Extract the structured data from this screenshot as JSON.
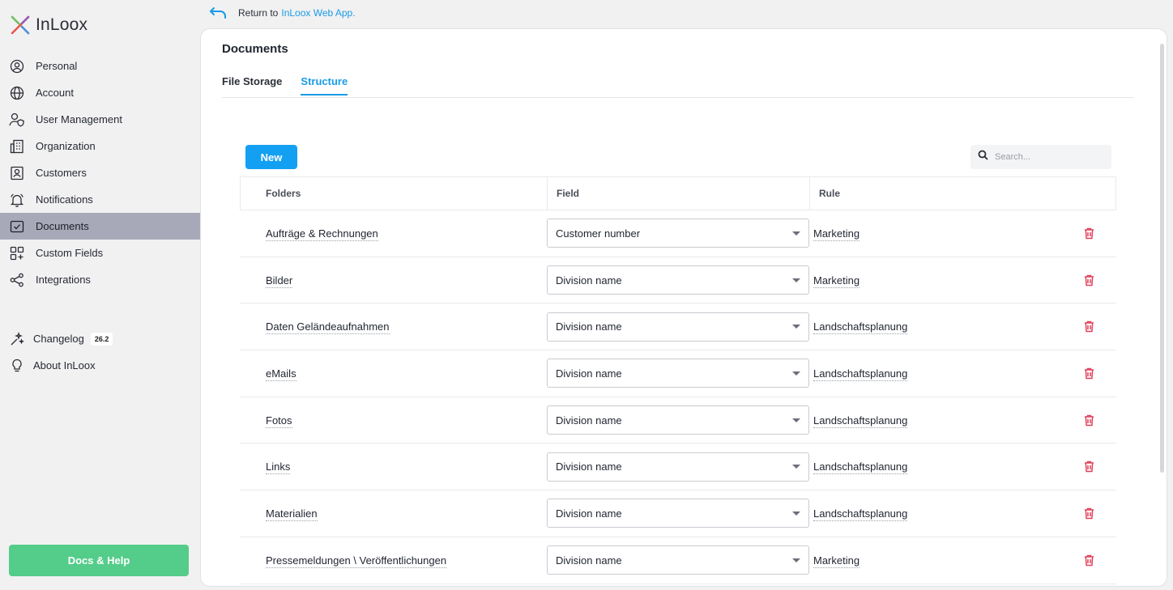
{
  "app": {
    "name": "InLoox"
  },
  "sidebar": {
    "items": [
      {
        "label": "Personal",
        "icon": "person-circle-icon"
      },
      {
        "label": "Account",
        "icon": "globe-icon"
      },
      {
        "label": "User Management",
        "icon": "user-shield-icon"
      },
      {
        "label": "Organization",
        "icon": "building-icon"
      },
      {
        "label": "Customers",
        "icon": "contact-card-icon"
      },
      {
        "label": "Notifications",
        "icon": "bell-icon"
      },
      {
        "label": "Documents",
        "icon": "folder-check-icon",
        "active": true
      },
      {
        "label": "Custom Fields",
        "icon": "grid-plus-icon"
      },
      {
        "label": "Integrations",
        "icon": "share-nodes-icon"
      }
    ],
    "secondary": [
      {
        "label": "Changelog",
        "icon": "sparkle-icon",
        "badge": "26.2"
      },
      {
        "label": "About InLoox",
        "icon": "lightbulb-icon"
      }
    ],
    "docs_help": "Docs & Help"
  },
  "return_link": {
    "prefix": "Return to",
    "link": "InLoox Web App."
  },
  "page": {
    "title": "Documents",
    "tabs": [
      {
        "label": "File Storage",
        "active": false
      },
      {
        "label": "Structure",
        "active": true
      }
    ]
  },
  "toolbar": {
    "new_label": "New",
    "search_placeholder": "Search..."
  },
  "table": {
    "headers": {
      "folders": "Folders",
      "field": "Field",
      "rule": "Rule"
    },
    "rows": [
      {
        "folder": "Aufträge & Rechnungen",
        "field": "Customer number",
        "rule": "Marketing"
      },
      {
        "folder": "Bilder",
        "field": "Division name",
        "rule": "Marketing"
      },
      {
        "folder": "Daten Geländeaufnahmen",
        "field": "Division name",
        "rule": "Landschaftsplanung"
      },
      {
        "folder": "eMails",
        "field": "Division name",
        "rule": "Landschaftsplanung"
      },
      {
        "folder": "Fotos",
        "field": "Division name",
        "rule": "Landschaftsplanung"
      },
      {
        "folder": "Links",
        "field": "Division name",
        "rule": "Landschaftsplanung"
      },
      {
        "folder": "Materialien",
        "field": "Division name",
        "rule": "Landschaftsplanung"
      },
      {
        "folder": "Pressemeldungen \\ Veröffentlichungen",
        "field": "Division name",
        "rule": "Marketing"
      }
    ]
  },
  "colors": {
    "accent": "#14a0f2",
    "active_nav": "#a7a9b8",
    "docs_button": "#54cc8a",
    "delete": "#e0405a"
  }
}
